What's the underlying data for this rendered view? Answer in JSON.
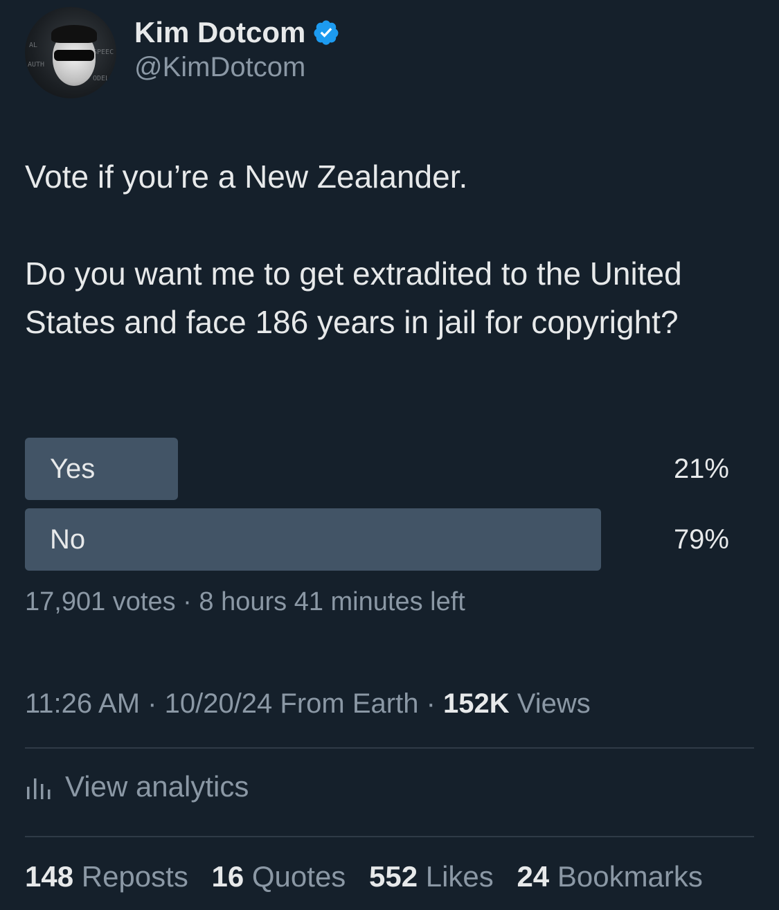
{
  "author": {
    "display_name": "Kim Dotcom",
    "handle": "@KimDotcom",
    "verified": true,
    "verified_color": "#1d9bf0"
  },
  "tweet": {
    "line1": "Vote if you’re a New Zealander.",
    "line2": "Do you want me to get extradited to the United States and face 186 years in jail for copyright?"
  },
  "poll": {
    "options": [
      {
        "label": "Yes",
        "percent_text": "21%",
        "percent": 21
      },
      {
        "label": "No",
        "percent_text": "79%",
        "percent": 79
      }
    ],
    "votes": "17,901 votes",
    "separator": " · ",
    "time_left": "8 hours 41 minutes left",
    "bar_color": "#425466"
  },
  "meta": {
    "time": "11:26 AM",
    "sep": " · ",
    "date": "10/20/24",
    "source": " From Earth",
    "views_count": "152K",
    "views_label": " Views"
  },
  "analytics": {
    "icon": "bar-chart-icon",
    "label": "View analytics"
  },
  "stats": [
    {
      "count": "148",
      "label": " Reposts"
    },
    {
      "count": "16",
      "label": " Quotes"
    },
    {
      "count": "552",
      "label": " Likes"
    },
    {
      "count": "24",
      "label": " Bookmarks"
    }
  ],
  "colors": {
    "background": "#15202b",
    "primary_text": "#e7e9ea",
    "secondary_text": "#8b98a5"
  }
}
